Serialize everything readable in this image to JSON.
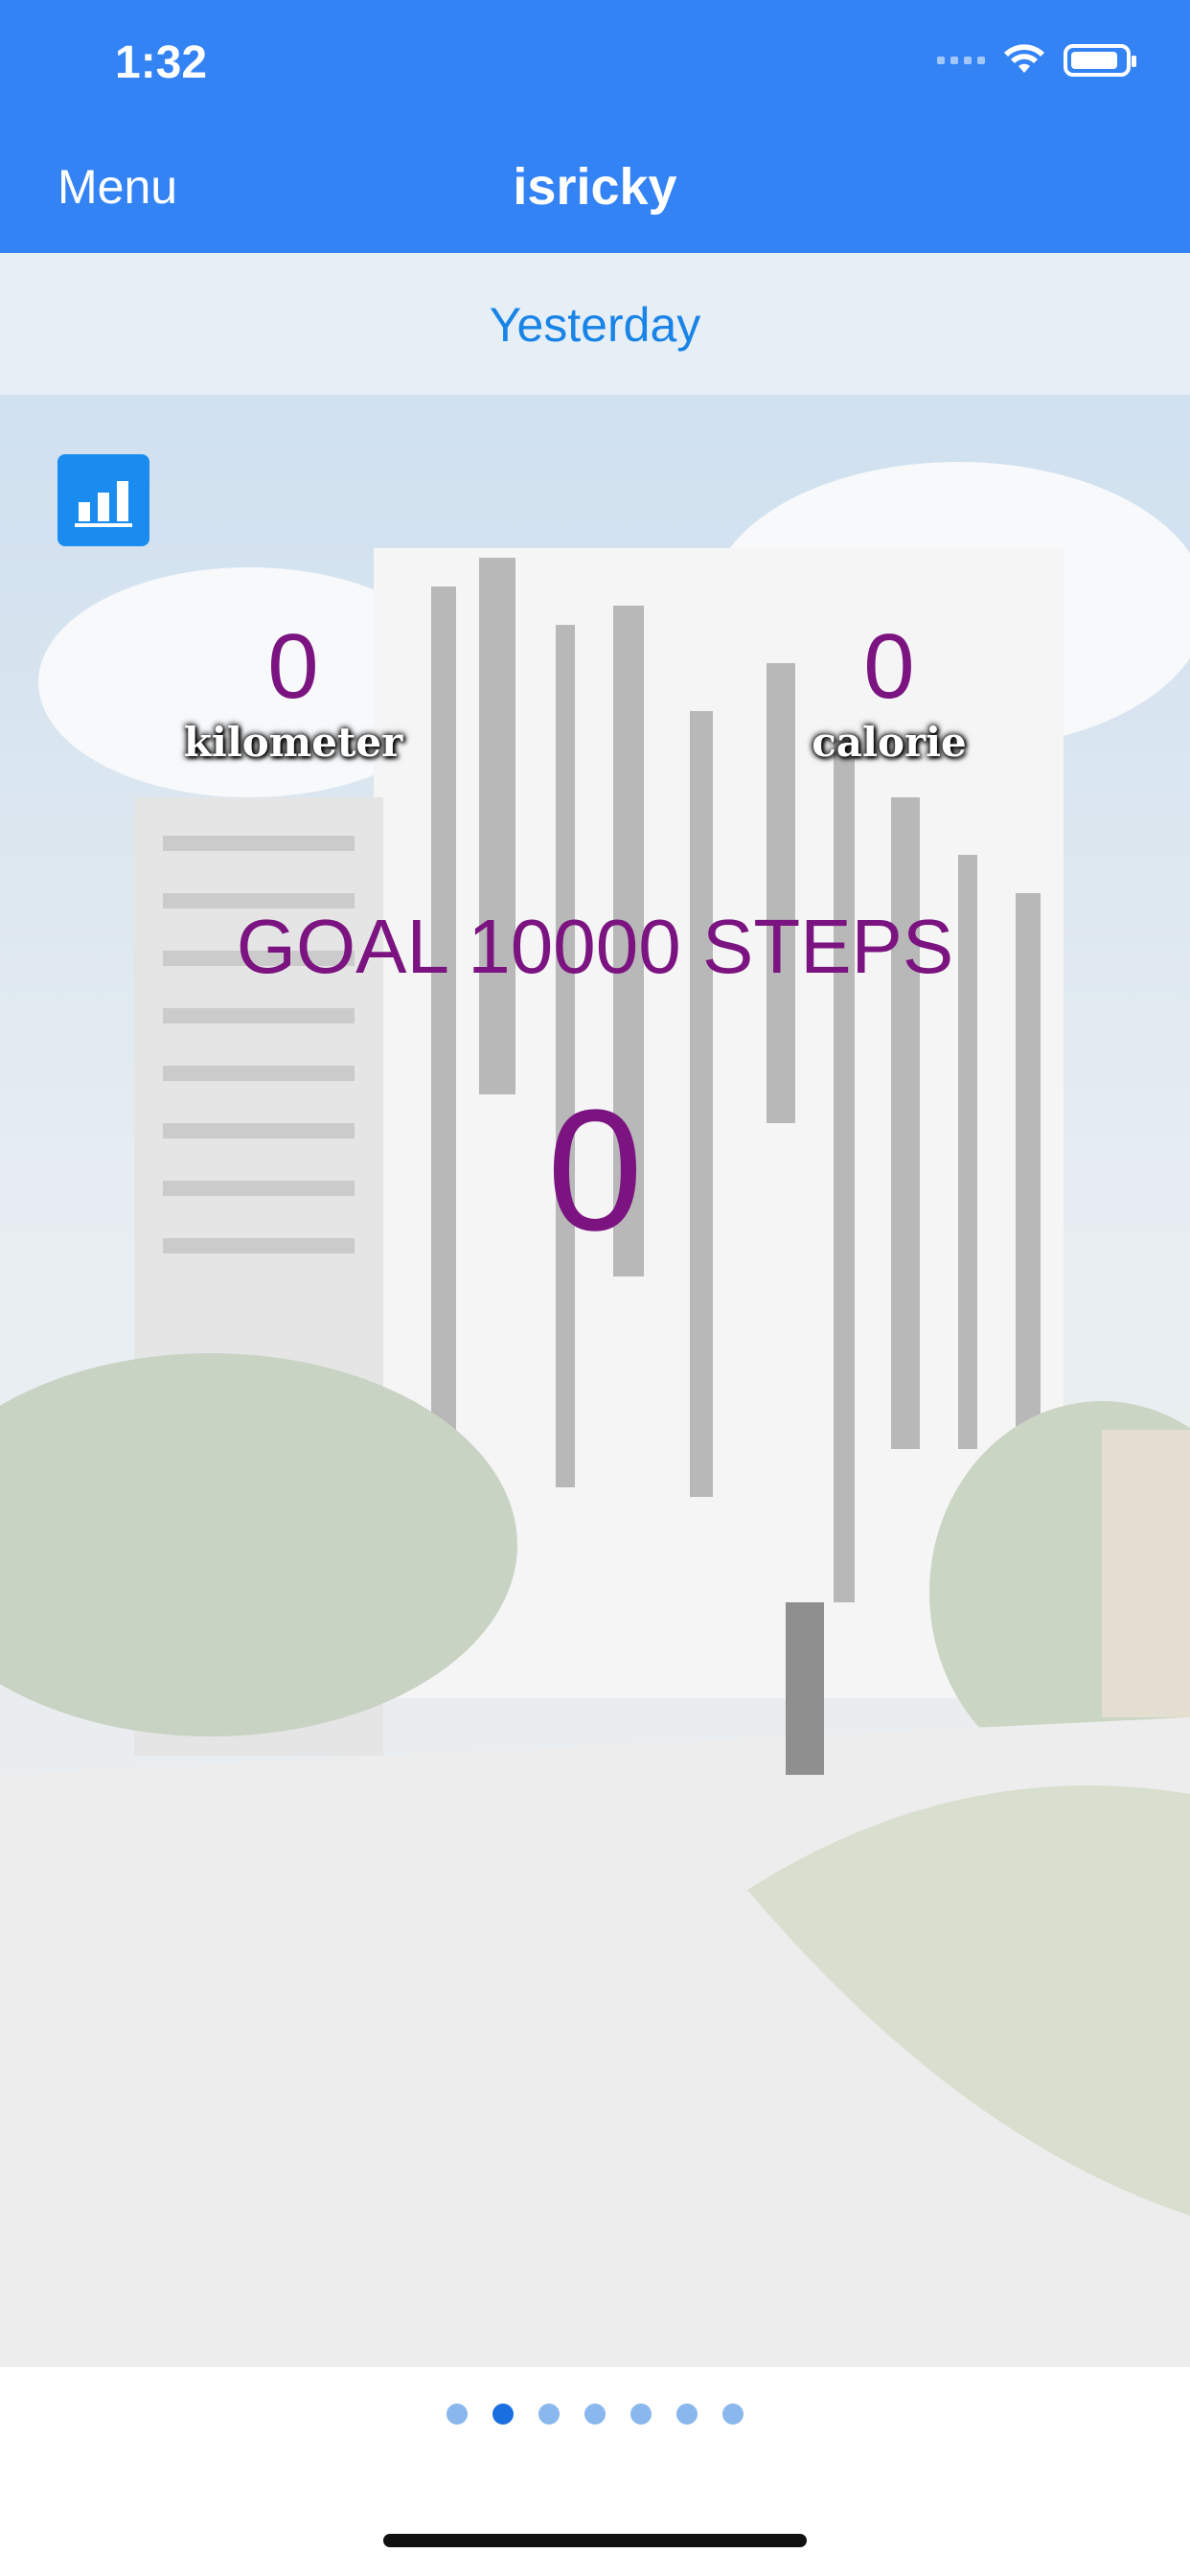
{
  "status_bar": {
    "time": "1:32"
  },
  "nav": {
    "menu_label": "Menu",
    "title": "isricky"
  },
  "date_selector": {
    "label": "Yesterday"
  },
  "stats": {
    "distance": {
      "value": "0",
      "label": "kilometer"
    },
    "calories": {
      "value": "0",
      "label": "calorie"
    }
  },
  "goal": {
    "text": "GOAL 10000 STEPS"
  },
  "steps": {
    "count": "0"
  },
  "pager": {
    "total_pages": 7,
    "active_index": 1
  },
  "colors": {
    "nav_blue": "#3483f5",
    "accent_purple": "#7b1480",
    "link_blue": "#1a84e6"
  }
}
